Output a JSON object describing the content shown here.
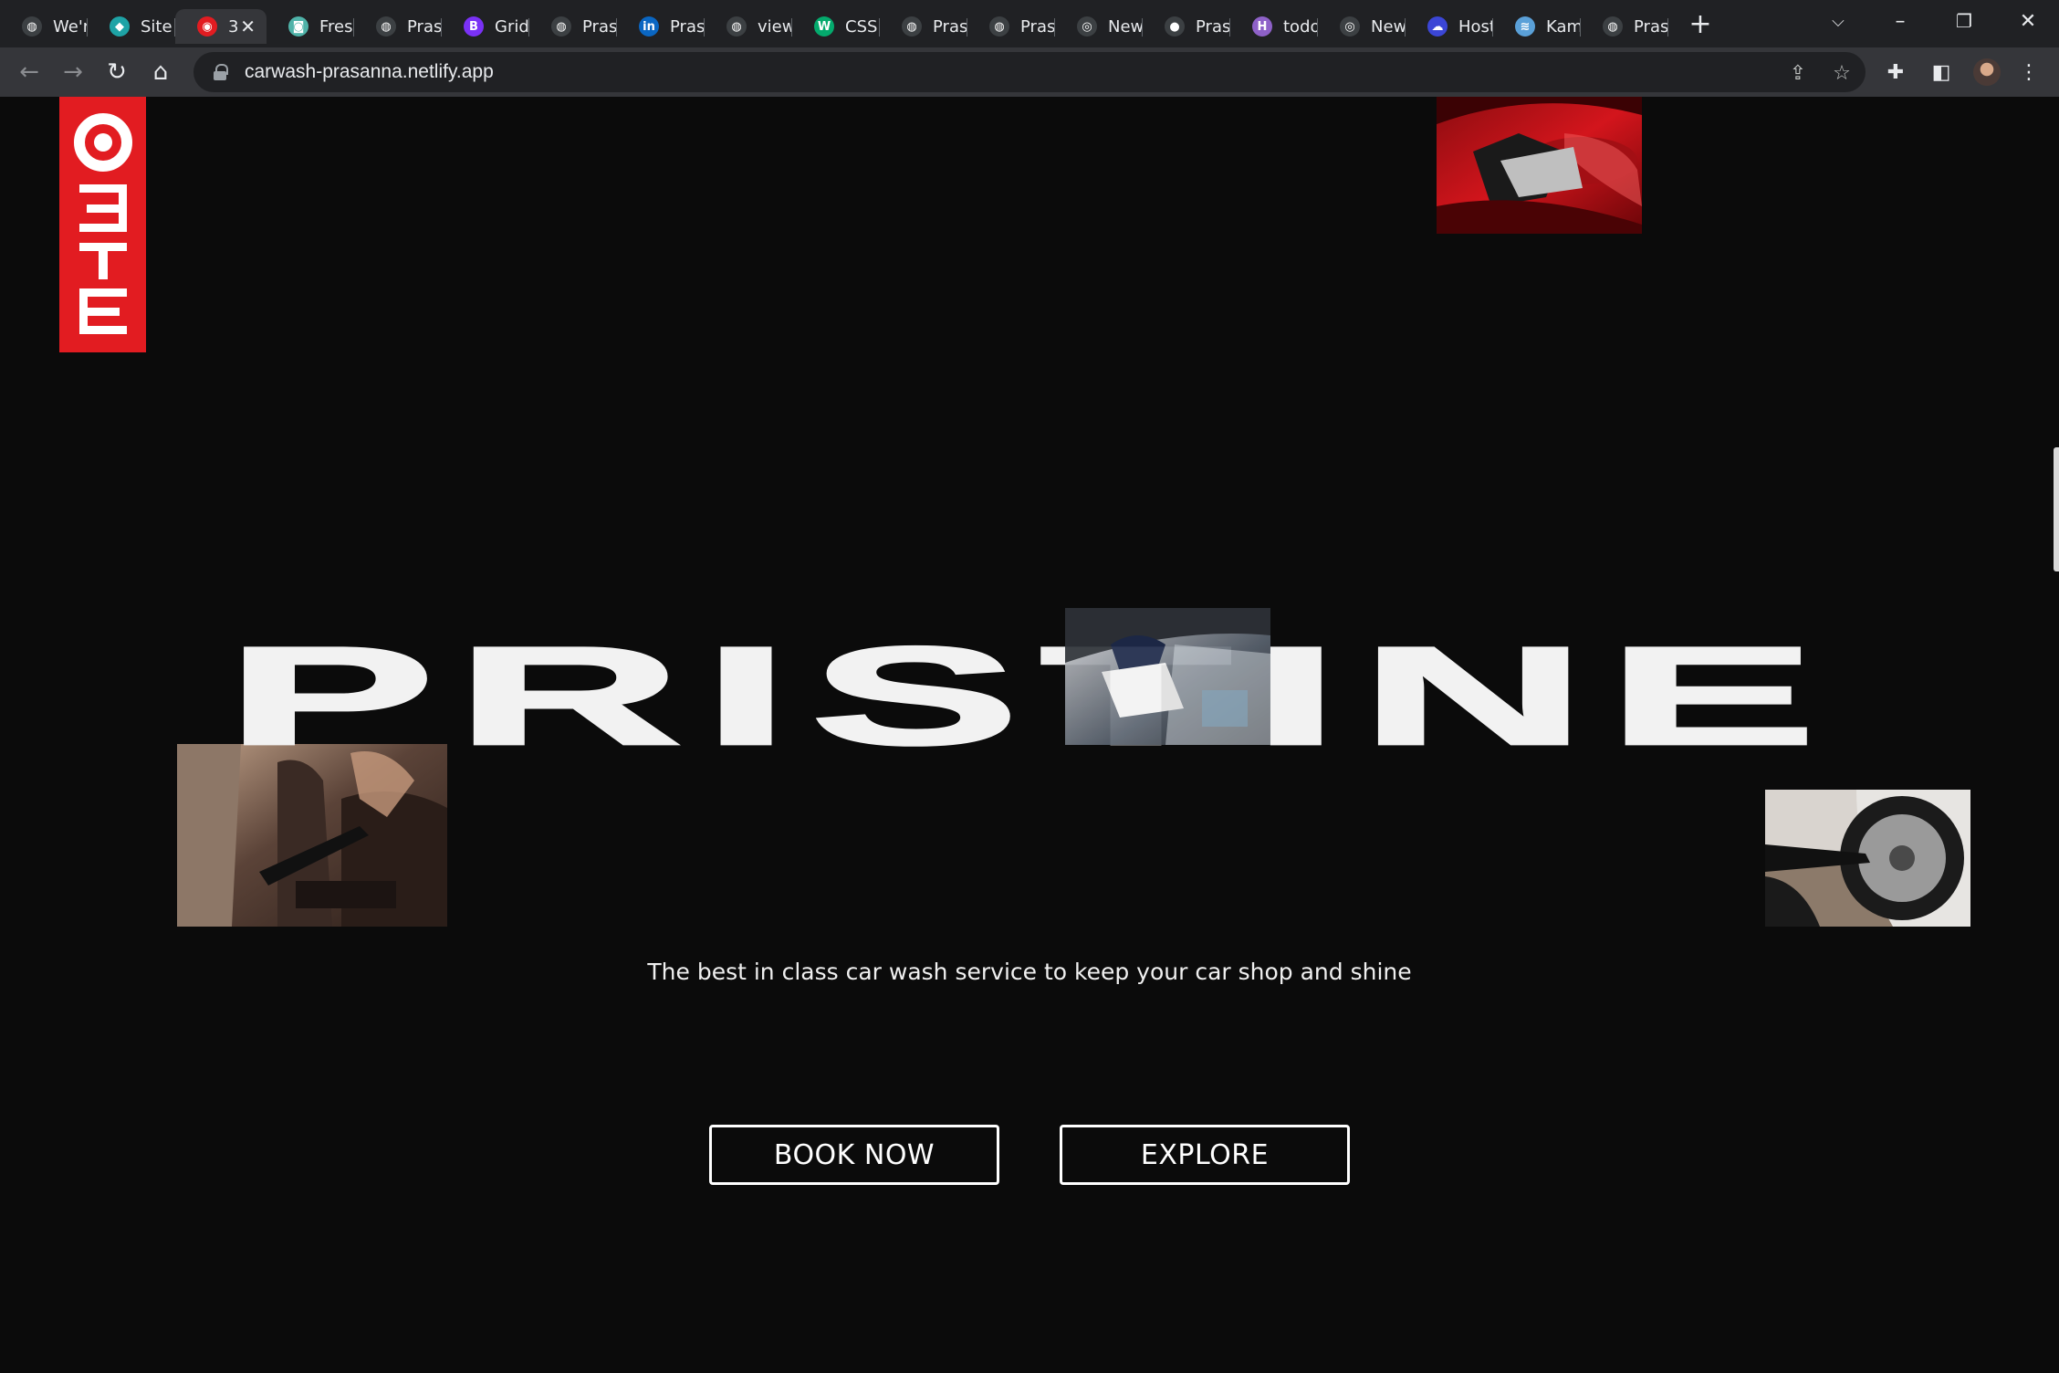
{
  "browser": {
    "tabs": [
      {
        "label": "We'r",
        "icon": "globe-icon",
        "color": "#3c4043"
      },
      {
        "label": "Site",
        "icon": "diamond-icon",
        "color": "#1ea3a6"
      },
      {
        "label": "3",
        "icon": "red-circle-icon",
        "color": "#e21c21",
        "active": true
      },
      {
        "label": "Fresl",
        "icon": "chat-icon",
        "color": "#4fb3a9"
      },
      {
        "label": "Pras",
        "icon": "globe-icon",
        "color": "#3c4043"
      },
      {
        "label": "Grid",
        "icon": "bootstrap-icon",
        "color": "#7a31f6"
      },
      {
        "label": "Pras",
        "icon": "globe-icon",
        "color": "#3c4043"
      },
      {
        "label": "Pras",
        "icon": "linkedin-icon",
        "color": "#0a66c2"
      },
      {
        "label": "view",
        "icon": "globe-icon",
        "color": "#3c4043"
      },
      {
        "label": "CSS",
        "icon": "w3schools-icon",
        "color": "#04aa6d"
      },
      {
        "label": "Pras",
        "icon": "globe-icon",
        "color": "#3c4043"
      },
      {
        "label": "Pras",
        "icon": "globe-icon",
        "color": "#3c4043"
      },
      {
        "label": "New",
        "icon": "chrome-icon",
        "color": "#3c4043"
      },
      {
        "label": "Pras",
        "icon": "github-icon",
        "color": "#3c4043"
      },
      {
        "label": "todo",
        "icon": "hashnode-icon",
        "color": "#8e61c8"
      },
      {
        "label": "New",
        "icon": "chrome-icon",
        "color": "#3c4043"
      },
      {
        "label": "Host",
        "icon": "cloud-icon",
        "color": "#3b46d6"
      },
      {
        "label": "Kam",
        "icon": "stack-icon",
        "color": "#5aa0d8"
      },
      {
        "label": "Pras",
        "icon": "globe-icon",
        "color": "#3c4043"
      }
    ],
    "url": "carwash-prasanna.netlify.app"
  },
  "logo": {
    "letters": "ƎTE",
    "color": "#e21c21"
  },
  "hero": {
    "title": "PRISTINE",
    "tagline": "The best in class car wash service to keep your car shop and shine"
  },
  "buttons": {
    "book": "BOOK NOW",
    "explore": "EXPLORE"
  }
}
